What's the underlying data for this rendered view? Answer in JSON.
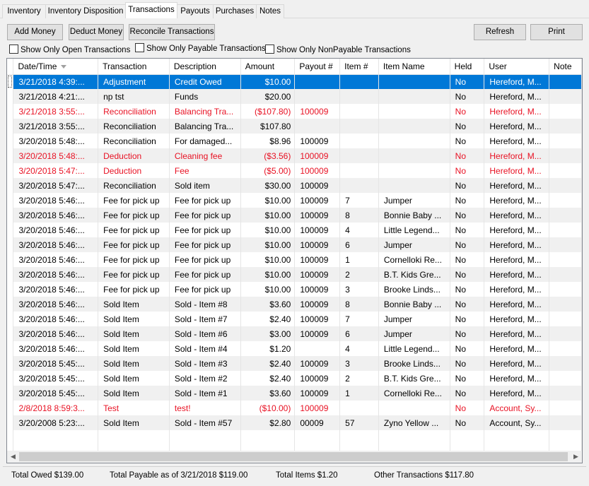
{
  "tabs": [
    "Inventory",
    "Inventory Disposition",
    "Transactions",
    "Payouts",
    "Purchases",
    "Notes"
  ],
  "toolbar": {
    "add_money": "Add Money",
    "deduct_money": "Deduct Money",
    "reconcile": "Reconcile Transactions",
    "refresh": "Refresh",
    "print": "Print"
  },
  "filters": {
    "open_only": "Show Only Open Transactions",
    "payable_only": "Show Only Payable Transactions",
    "nonpayable_only": "Show Only NonPayable Transactions"
  },
  "columns": [
    "Date/Time",
    "Transaction",
    "Description",
    "Amount",
    "Payout #",
    "Item #",
    "Item Name",
    "Held",
    "User",
    "Note"
  ],
  "rows": [
    {
      "datetime": "3/21/2018 4:39:...",
      "transaction": "Adjustment",
      "description": "Credit Owed",
      "amount": "$10.00",
      "payout": "",
      "item": "",
      "item_name": "",
      "held": "No",
      "user": "Hereford, M...",
      "note": "",
      "style": "selected"
    },
    {
      "datetime": "3/21/2018 4:21:...",
      "transaction": "np tst",
      "description": "Funds",
      "amount": "$20.00",
      "payout": "",
      "item": "",
      "item_name": "",
      "held": "No",
      "user": "Hereford, M...",
      "note": "",
      "style": "normal"
    },
    {
      "datetime": "3/21/2018 3:55:...",
      "transaction": "Reconciliation",
      "description": "Balancing Tra...",
      "amount": "($107.80)",
      "payout": "100009",
      "item": "",
      "item_name": "",
      "held": "No",
      "user": "Hereford, M...",
      "note": "",
      "style": "red"
    },
    {
      "datetime": "3/21/2018 3:55:...",
      "transaction": "Reconciliation",
      "description": "Balancing Tra...",
      "amount": "$107.80",
      "payout": "",
      "item": "",
      "item_name": "",
      "held": "No",
      "user": "Hereford, M...",
      "note": "",
      "style": "normal"
    },
    {
      "datetime": "3/20/2018 5:48:...",
      "transaction": "Reconciliation",
      "description": "For damaged...",
      "amount": "$8.96",
      "payout": "100009",
      "item": "",
      "item_name": "",
      "held": "No",
      "user": "Hereford, M...",
      "note": "",
      "style": "normal"
    },
    {
      "datetime": "3/20/2018 5:48:...",
      "transaction": "Deduction",
      "description": "Cleaning fee",
      "amount": "($3.56)",
      "payout": "100009",
      "item": "",
      "item_name": "",
      "held": "No",
      "user": "Hereford, M...",
      "note": "",
      "style": "red"
    },
    {
      "datetime": "3/20/2018 5:47:...",
      "transaction": "Deduction",
      "description": "Fee",
      "amount": "($5.00)",
      "payout": "100009",
      "item": "",
      "item_name": "",
      "held": "No",
      "user": "Hereford, M...",
      "note": "",
      "style": "red"
    },
    {
      "datetime": "3/20/2018 5:47:...",
      "transaction": "Reconciliation",
      "description": "Sold item",
      "amount": "$30.00",
      "payout": "100009",
      "item": "",
      "item_name": "",
      "held": "No",
      "user": "Hereford, M...",
      "note": "",
      "style": "normal"
    },
    {
      "datetime": "3/20/2018 5:46:...",
      "transaction": "Fee for pick up",
      "description": "Fee for pick up",
      "amount": "$10.00",
      "payout": "100009",
      "item": "7",
      "item_name": "Jumper",
      "held": "No",
      "user": "Hereford, M...",
      "note": "",
      "style": "normal"
    },
    {
      "datetime": "3/20/2018 5:46:...",
      "transaction": "Fee for pick up",
      "description": "Fee for pick up",
      "amount": "$10.00",
      "payout": "100009",
      "item": "8",
      "item_name": "Bonnie Baby ...",
      "held": "No",
      "user": "Hereford, M...",
      "note": "",
      "style": "normal"
    },
    {
      "datetime": "3/20/2018 5:46:...",
      "transaction": "Fee for pick up",
      "description": "Fee for pick up",
      "amount": "$10.00",
      "payout": "100009",
      "item": "4",
      "item_name": "Little Legend...",
      "held": "No",
      "user": "Hereford, M...",
      "note": "",
      "style": "normal"
    },
    {
      "datetime": "3/20/2018 5:46:...",
      "transaction": "Fee for pick up",
      "description": "Fee for pick up",
      "amount": "$10.00",
      "payout": "100009",
      "item": "6",
      "item_name": "Jumper",
      "held": "No",
      "user": "Hereford, M...",
      "note": "",
      "style": "normal"
    },
    {
      "datetime": "3/20/2018 5:46:...",
      "transaction": "Fee for pick up",
      "description": "Fee for pick up",
      "amount": "$10.00",
      "payout": "100009",
      "item": "1",
      "item_name": "Cornelloki Re...",
      "held": "No",
      "user": "Hereford, M...",
      "note": "",
      "style": "normal"
    },
    {
      "datetime": "3/20/2018 5:46:...",
      "transaction": "Fee for pick up",
      "description": "Fee for pick up",
      "amount": "$10.00",
      "payout": "100009",
      "item": "2",
      "item_name": "B.T. Kids Gre...",
      "held": "No",
      "user": "Hereford, M...",
      "note": "",
      "style": "normal"
    },
    {
      "datetime": "3/20/2018 5:46:...",
      "transaction": "Fee for pick up",
      "description": "Fee for pick up",
      "amount": "$10.00",
      "payout": "100009",
      "item": "3",
      "item_name": "Brooke Linds...",
      "held": "No",
      "user": "Hereford, M...",
      "note": "",
      "style": "normal"
    },
    {
      "datetime": "3/20/2018 5:46:...",
      "transaction": "Sold Item",
      "description": "Sold - Item #8",
      "amount": "$3.60",
      "payout": "100009",
      "item": "8",
      "item_name": "Bonnie Baby ...",
      "held": "No",
      "user": "Hereford, M...",
      "note": "",
      "style": "normal"
    },
    {
      "datetime": "3/20/2018 5:46:...",
      "transaction": "Sold Item",
      "description": "Sold - Item #7",
      "amount": "$2.40",
      "payout": "100009",
      "item": "7",
      "item_name": "Jumper",
      "held": "No",
      "user": "Hereford, M...",
      "note": "",
      "style": "normal"
    },
    {
      "datetime": "3/20/2018 5:46:...",
      "transaction": "Sold Item",
      "description": "Sold - Item #6",
      "amount": "$3.00",
      "payout": "100009",
      "item": "6",
      "item_name": "Jumper",
      "held": "No",
      "user": "Hereford, M...",
      "note": "",
      "style": "normal"
    },
    {
      "datetime": "3/20/2018 5:46:...",
      "transaction": "Sold Item",
      "description": "Sold - Item #4",
      "amount": "$1.20",
      "payout": "",
      "item": "4",
      "item_name": "Little Legend...",
      "held": "No",
      "user": "Hereford, M...",
      "note": "",
      "style": "normal"
    },
    {
      "datetime": "3/20/2018 5:45:...",
      "transaction": "Sold Item",
      "description": "Sold - Item #3",
      "amount": "$2.40",
      "payout": "100009",
      "item": "3",
      "item_name": "Brooke Linds...",
      "held": "No",
      "user": "Hereford, M...",
      "note": "",
      "style": "normal"
    },
    {
      "datetime": "3/20/2018 5:45:...",
      "transaction": "Sold Item",
      "description": "Sold - Item #2",
      "amount": "$2.40",
      "payout": "100009",
      "item": "2",
      "item_name": "B.T. Kids Gre...",
      "held": "No",
      "user": "Hereford, M...",
      "note": "",
      "style": "normal"
    },
    {
      "datetime": "3/20/2018 5:45:...",
      "transaction": "Sold Item",
      "description": "Sold - Item #1",
      "amount": "$3.60",
      "payout": "100009",
      "item": "1",
      "item_name": "Cornelloki Re...",
      "held": "No",
      "user": "Hereford, M...",
      "note": "",
      "style": "normal"
    },
    {
      "datetime": "2/8/2018 8:59:3...",
      "transaction": "Test",
      "description": "test!",
      "amount": "($10.00)",
      "payout": "100009",
      "item": "",
      "item_name": "",
      "held": "No",
      "user": "Account, Sy...",
      "note": "",
      "style": "red"
    },
    {
      "datetime": "3/20/2008 5:23:...",
      "transaction": "Sold Item",
      "description": "Sold - Item #57",
      "amount": "$2.80",
      "payout": "00009",
      "item": "57",
      "item_name": "Zyno Yellow ...",
      "held": "No",
      "user": "Account, Sy...",
      "note": "",
      "style": "normal"
    }
  ],
  "footer": {
    "total_owed": "Total Owed  $139.00",
    "total_payable": "Total Payable as of 3/21/2018  $119.00",
    "total_items": "Total Items  $1.20",
    "other_transactions": "Other Transactions  $117.80"
  },
  "colors": {
    "selection": "#0078d7",
    "negative": "#e81123",
    "alt_row": "#f0f0f0"
  }
}
